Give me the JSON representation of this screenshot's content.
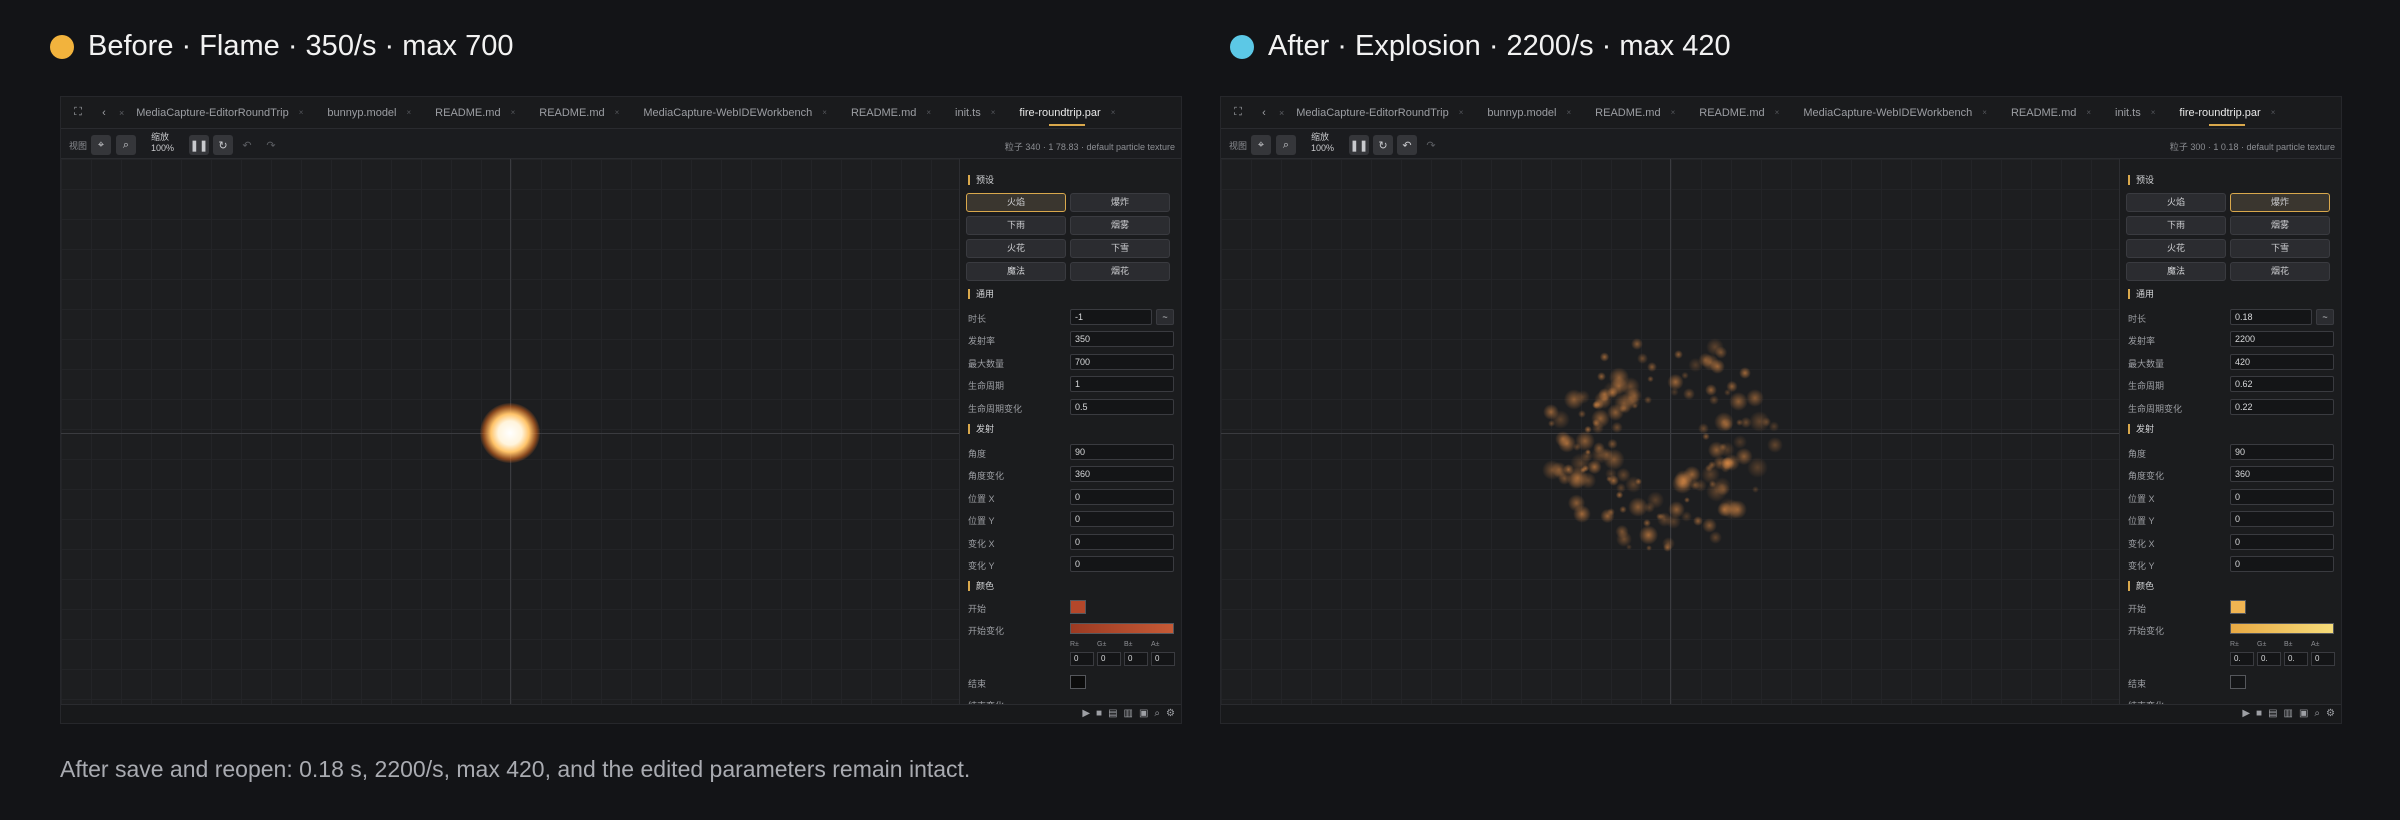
{
  "before": {
    "heading": "Before · Flame · 350/s · max 700",
    "dot_color": "#f2b33d",
    "status": "粒子 340 · 1 78.83 · default particle texture",
    "selected_preset": "火焰",
    "fields": {
      "duration": "-1",
      "rate": "350",
      "max": "700",
      "life": "1",
      "life_var": "0.5",
      "angle": "90",
      "angle_var": "360",
      "pos_x": "0",
      "pos_y": "0",
      "var_x": "0",
      "var_y": "0"
    },
    "color_start": "#b4472a",
    "color_gradient_from": "#9c3a22",
    "color_gradient_to": "#c65a36",
    "rgba_values": [
      "0",
      "0",
      "0",
      "0"
    ],
    "color_end": "#0c0c0c"
  },
  "after": {
    "heading": "After · Explosion · 2200/s · max 420",
    "dot_color": "#5cc8e6",
    "status": "粒子 300 · 1 0.18 · default particle texture",
    "selected_preset": "爆炸",
    "fields": {
      "duration": "0.18",
      "rate": "2200",
      "max": "420",
      "life": "0.62",
      "life_var": "0.22",
      "angle": "90",
      "angle_var": "360",
      "pos_x": "0",
      "pos_y": "0",
      "var_x": "0",
      "var_y": "0"
    },
    "color_start": "#f0b452",
    "color_gradient_from": "#e8a944",
    "color_gradient_to": "#f6dc7a",
    "rgba_values": [
      "0.",
      "0.",
      "0.",
      "0"
    ],
    "color_end": "#141517"
  },
  "shared": {
    "tabs": [
      "MediaCapture-EditorRoundTrip",
      "bunnyp.model",
      "README.md",
      "README.md",
      "MediaCapture-WebIDEWorkbench",
      "README.md",
      "init.ts",
      "fire-roundtrip.par"
    ],
    "active_tab": "fire-roundtrip.par",
    "toolbar_view_label": "视图",
    "zoom_label": "缩放",
    "zoom_value": "100%",
    "sections": {
      "presets": "预设",
      "general": "通用",
      "emission": "发射",
      "color": "颜色"
    },
    "presets": [
      "火焰",
      "爆炸",
      "下雨",
      "烟雾",
      "火花",
      "下雪",
      "魔法",
      "烟花"
    ],
    "labels": {
      "duration": "时长",
      "rate": "发射率",
      "max": "最大数量",
      "life": "生命周期",
      "life_var": "生命周期变化",
      "angle": "角度",
      "angle_var": "角度变化",
      "pos_x": "位置 X",
      "pos_y": "位置 Y",
      "var_x": "变化 X",
      "var_y": "变化 Y",
      "start": "开始",
      "start_var": "开始变化",
      "end": "结束",
      "end_var": "结束变化"
    },
    "tilde": "~",
    "channel_labels": [
      "R±",
      "G±",
      "B±",
      "A±"
    ]
  },
  "caption": "After save and reopen: 0.18 s, 2200/s, max 420, and the edited parameters remain intact."
}
